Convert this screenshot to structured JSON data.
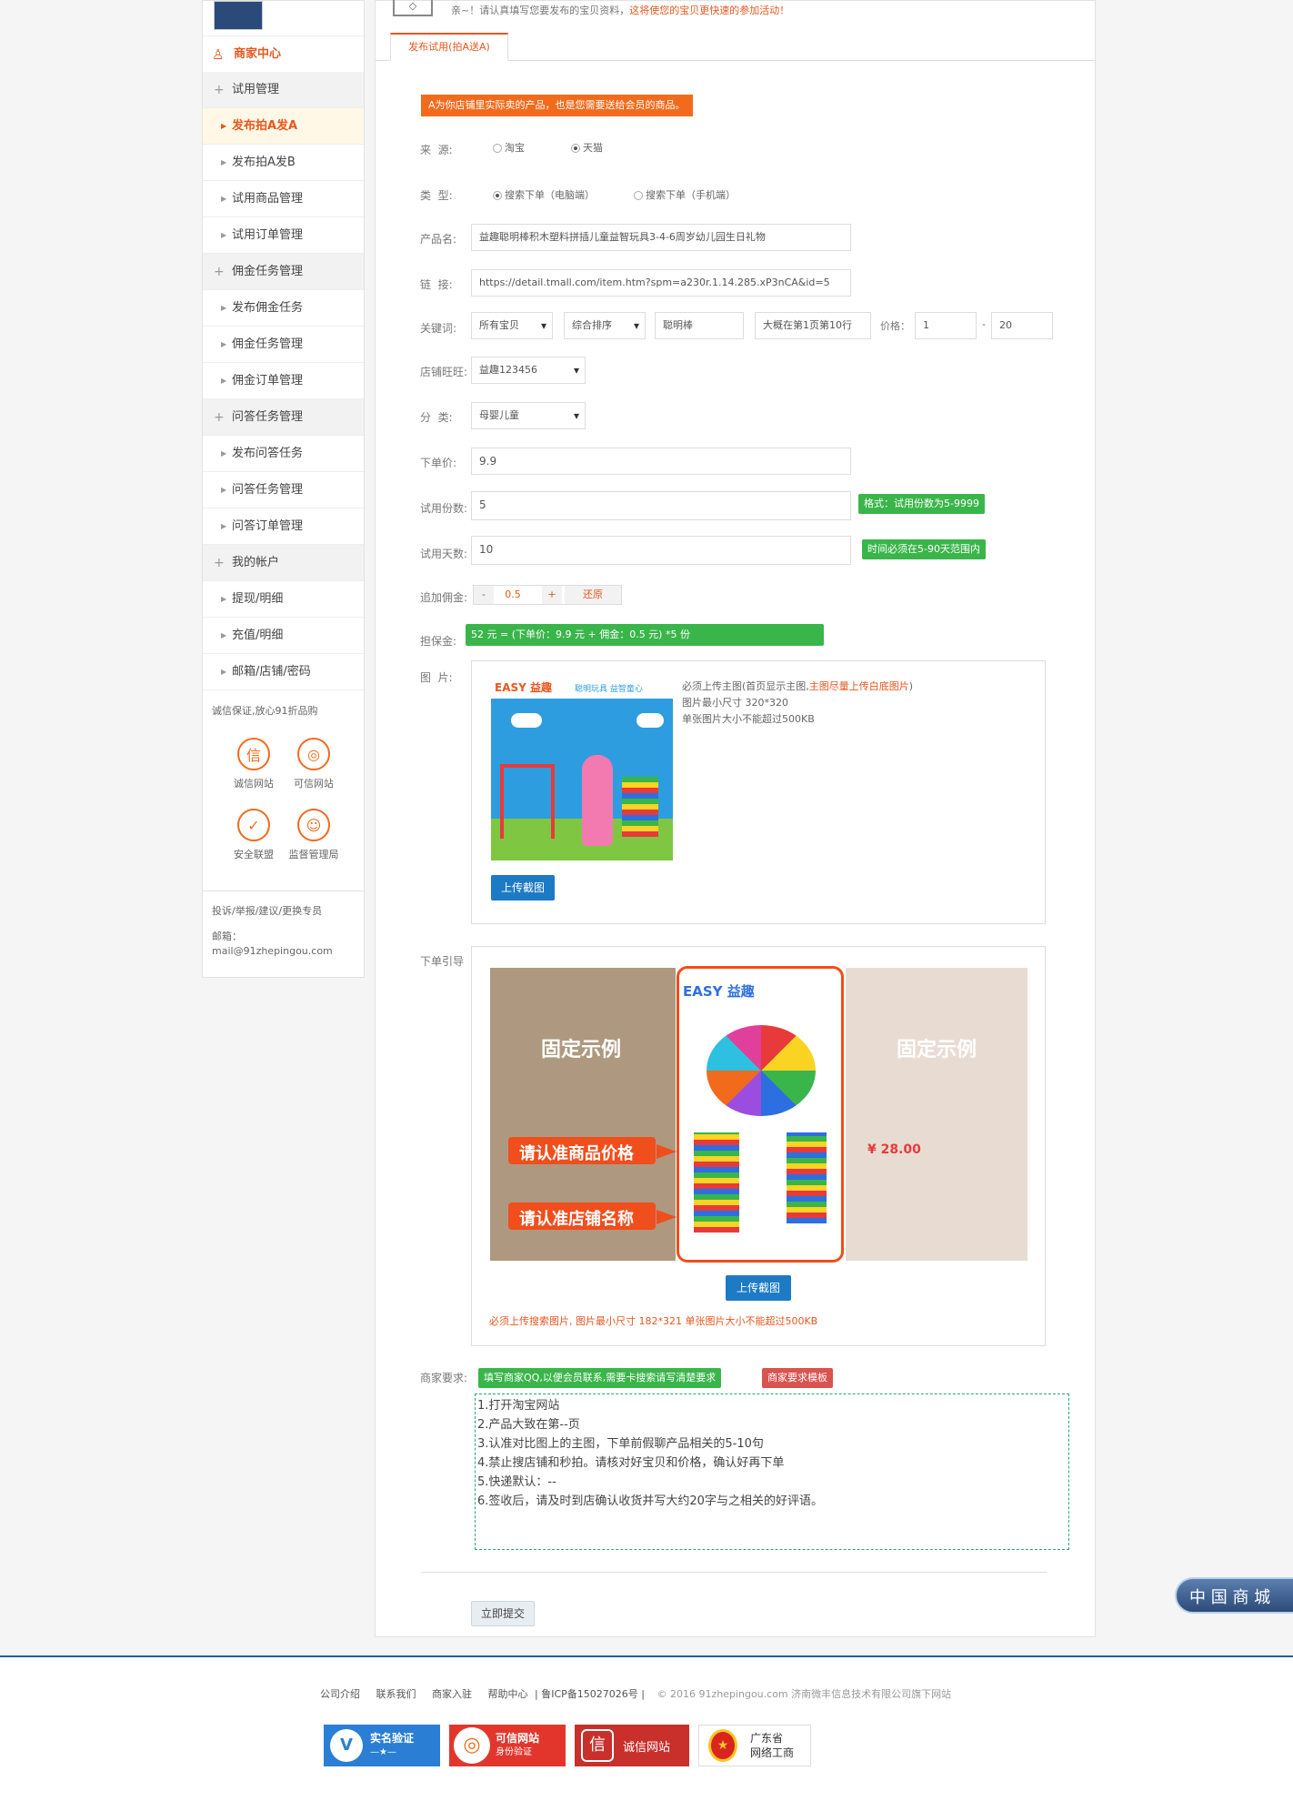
{
  "top": {
    "notice_prefix": "亲~！请认真填写您要发布的宝贝资料，",
    "notice_hint": "这将使您的宝贝更快速的参加活动！",
    "tab_label": "发布试用(拍A送A)"
  },
  "sidebar": {
    "header": "商家中心",
    "groups": [
      {
        "label": "试用管理",
        "items": [
          "发布拍A发A",
          "发布拍A发B",
          "试用商品管理",
          "试用订单管理"
        ]
      },
      {
        "label": "佣金任务管理",
        "items": [
          "发布佣金任务",
          "佣金任务管理",
          "佣金订单管理"
        ]
      },
      {
        "label": "问答任务管理",
        "items": [
          "发布问答任务",
          "问答任务管理",
          "问答订单管理"
        ]
      },
      {
        "label": "我的帐户",
        "items": [
          "提现/明细",
          "充值/明细",
          "邮箱/店铺/密码"
        ]
      }
    ],
    "trust_title": "诚信保证,放心91折品购",
    "badges": [
      "诚信网站",
      "可信网站",
      "安全联盟",
      "监督管理局"
    ],
    "badge_glyphs": [
      "信",
      "◎",
      "✓",
      "☺"
    ],
    "contact_title": "投诉/举报/建议/更换专员",
    "email_label": "邮箱：",
    "email": "mail@91zhepingou.com"
  },
  "form": {
    "warning": "A为你店铺里实际卖的产品，也是您需要送给会员的商品。",
    "source": {
      "label": "来  源:",
      "options": [
        "淘宝",
        "天猫"
      ],
      "selected": 1
    },
    "type": {
      "label": "类  型:",
      "options": [
        "搜索下单（电脑端）",
        "搜索下单（手机端）"
      ],
      "selected": 0
    },
    "product": {
      "label": "产品名:",
      "value": "益趣聪明棒积木塑料拼插儿童益智玩具3-4-6周岁幼儿园生日礼物"
    },
    "link": {
      "label": "链  接:",
      "value": "https://detail.tmall.com/item.htm?spm=a230r.1.14.285.xP3nCA&id=5"
    },
    "keyword": {
      "label": "关键词:",
      "scope": "所有宝贝",
      "sort": "综合排序",
      "term": "聪明棒",
      "position": "大概在第1页第10行",
      "price_label": "价格：",
      "price_min": "1",
      "price_sep": "-",
      "price_max": "20"
    },
    "shop": {
      "label": "店铺旺旺:",
      "value": "益趣123456"
    },
    "category": {
      "label": "分  类:",
      "value": "母婴儿童"
    },
    "price": {
      "label": "下单价:",
      "value": "9.9"
    },
    "copies": {
      "label": "试用份数:",
      "value": "5",
      "hint": "格式：试用份数为5-9999"
    },
    "days": {
      "label": "试用天数:",
      "value": "10",
      "hint": "时间必须在5-90天范围内"
    },
    "commission": {
      "label": "追加佣金:",
      "minus": "-",
      "value": "0.5",
      "plus": "+",
      "reset": "还原"
    },
    "deposit": {
      "label": "担保金:",
      "text": "52 元 = (下单价：9.9 元 + 佣金：0.5 元) *5 份"
    },
    "image": {
      "label": "图  片:",
      "req1_prefix": "必须上传主图(首页显示主图,",
      "req1_hint": "主图尽量上传白底图片",
      "req1_suffix": ")",
      "req2": "图片最小尺寸 320*320",
      "req3": "单张图片大小不能超过500KB",
      "upload": "上传截图",
      "brand": "EASY 益趣",
      "slogan": "聪明玩具 益智童心"
    },
    "guide": {
      "label": "下单引导",
      "example_left": "固定示例",
      "example_right": "固定示例",
      "tip_price": "请认准商品价格",
      "tip_shop": "请认准店铺名称",
      "brand": "EASY 益趣",
      "price_tag": "¥ 28.00",
      "upload": "上传截图",
      "note": "必须上传搜索图片, 图片最小尺寸 182*321 单张图片大小不能超过500KB"
    },
    "requirements": {
      "label": "商家要求:",
      "qq_hint": "填写商家QQ,以便会员联系,需要卡搜索请写清楚要求",
      "template": "商家要求模板",
      "lines": [
        "1.打开淘宝网站",
        "2.产品大致在第--页",
        "3.认准对比图上的主图，下单前假聊产品相关的5-10句",
        "4.禁止搜店铺和秒拍。请核对好宝贝和价格，确认好再下单",
        "5.快递默认：--",
        "6.签收后，请及时到店确认收货并写大约20字与之相关的好评语。"
      ]
    },
    "submit": "立即提交"
  },
  "float_badge": "中 国 商 城",
  "footer": {
    "links": [
      "公司介绍",
      "联系我们",
      "商家入驻",
      "帮助中心"
    ],
    "icp": "| 鲁ICP备15027026号 |",
    "copyright": "© 2016 91zhepingou.com 济南微丰信息技术有限公司旗下网站",
    "seals": [
      {
        "title": "实名验证",
        "sub": "—★—"
      },
      {
        "title": "可信网站",
        "sub": "身份验证"
      },
      {
        "title": "诚信网站",
        "sub": ""
      },
      {
        "title": "广东省",
        "sub": "网络工商"
      }
    ]
  },
  "colors": {
    "orange": "#f26b1d",
    "green": "#3ab54a",
    "blue": "#1d7ac5",
    "red": "#d9534f"
  }
}
